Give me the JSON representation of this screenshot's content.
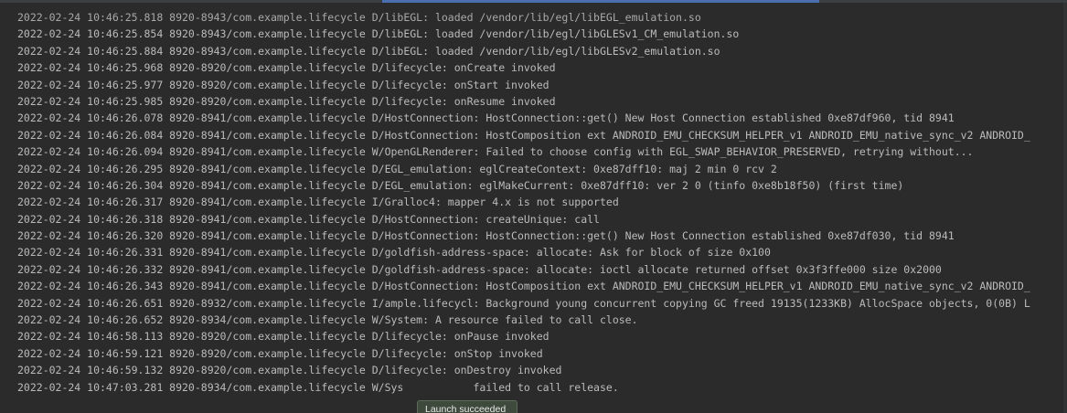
{
  "logcat": {
    "lines": [
      "2022-02-24 10:46:25.818 8920-8943/com.example.lifecycle D/libEGL: loaded /vendor/lib/egl/libEGL_emulation.so",
      "2022-02-24 10:46:25.854 8920-8943/com.example.lifecycle D/libEGL: loaded /vendor/lib/egl/libGLESv1_CM_emulation.so",
      "2022-02-24 10:46:25.884 8920-8943/com.example.lifecycle D/libEGL: loaded /vendor/lib/egl/libGLESv2_emulation.so",
      "2022-02-24 10:46:25.968 8920-8920/com.example.lifecycle D/lifecycle: onCreate invoked",
      "2022-02-24 10:46:25.977 8920-8920/com.example.lifecycle D/lifecycle: onStart invoked",
      "2022-02-24 10:46:25.985 8920-8920/com.example.lifecycle D/lifecycle: onResume invoked",
      "2022-02-24 10:46:26.078 8920-8941/com.example.lifecycle D/HostConnection: HostConnection::get() New Host Connection established 0xe87df960, tid 8941",
      "2022-02-24 10:46:26.084 8920-8941/com.example.lifecycle D/HostConnection: HostComposition ext ANDROID_EMU_CHECKSUM_HELPER_v1 ANDROID_EMU_native_sync_v2 ANDROID_",
      "2022-02-24 10:46:26.094 8920-8941/com.example.lifecycle W/OpenGLRenderer: Failed to choose config with EGL_SWAP_BEHAVIOR_PRESERVED, retrying without...",
      "2022-02-24 10:46:26.295 8920-8941/com.example.lifecycle D/EGL_emulation: eglCreateContext: 0xe87dff10: maj 2 min 0 rcv 2",
      "2022-02-24 10:46:26.304 8920-8941/com.example.lifecycle D/EGL_emulation: eglMakeCurrent: 0xe87dff10: ver 2 0 (tinfo 0xe8b18f50) (first time)",
      "2022-02-24 10:46:26.317 8920-8941/com.example.lifecycle I/Gralloc4: mapper 4.x is not supported",
      "2022-02-24 10:46:26.318 8920-8941/com.example.lifecycle D/HostConnection: createUnique: call",
      "2022-02-24 10:46:26.320 8920-8941/com.example.lifecycle D/HostConnection: HostConnection::get() New Host Connection established 0xe87df030, tid 8941",
      "2022-02-24 10:46:26.331 8920-8941/com.example.lifecycle D/goldfish-address-space: allocate: Ask for block of size 0x100",
      "2022-02-24 10:46:26.332 8920-8941/com.example.lifecycle D/goldfish-address-space: allocate: ioctl allocate returned offset 0x3f3ffe000 size 0x2000",
      "2022-02-24 10:46:26.343 8920-8941/com.example.lifecycle D/HostConnection: HostComposition ext ANDROID_EMU_CHECKSUM_HELPER_v1 ANDROID_EMU_native_sync_v2 ANDROID_",
      "2022-02-24 10:46:26.651 8920-8932/com.example.lifecycle I/ample.lifecycl: Background young concurrent copying GC freed 19135(1233KB) AllocSpace objects, 0(0B) L",
      "2022-02-24 10:46:26.652 8920-8934/com.example.lifecycle W/System: A resource failed to call close.",
      "2022-02-24 10:46:58.113 8920-8920/com.example.lifecycle D/lifecycle: onPause invoked",
      "2022-02-24 10:46:59.121 8920-8920/com.example.lifecycle D/lifecycle: onStop invoked",
      "2022-02-24 10:46:59.132 8920-8920/com.example.lifecycle D/lifecycle: onDestroy invoked",
      "2022-02-24 10:47:03.281 8920-8934/com.example.lifecycle W/Sys           failed to call release."
    ]
  },
  "toast": {
    "text": "Launch succeeded"
  },
  "colors": {
    "background": "#2b2b2b",
    "debug_text": "#bbbbbb",
    "warn_text": "#bbb529",
    "toast_bg": "#3e4a3c"
  }
}
